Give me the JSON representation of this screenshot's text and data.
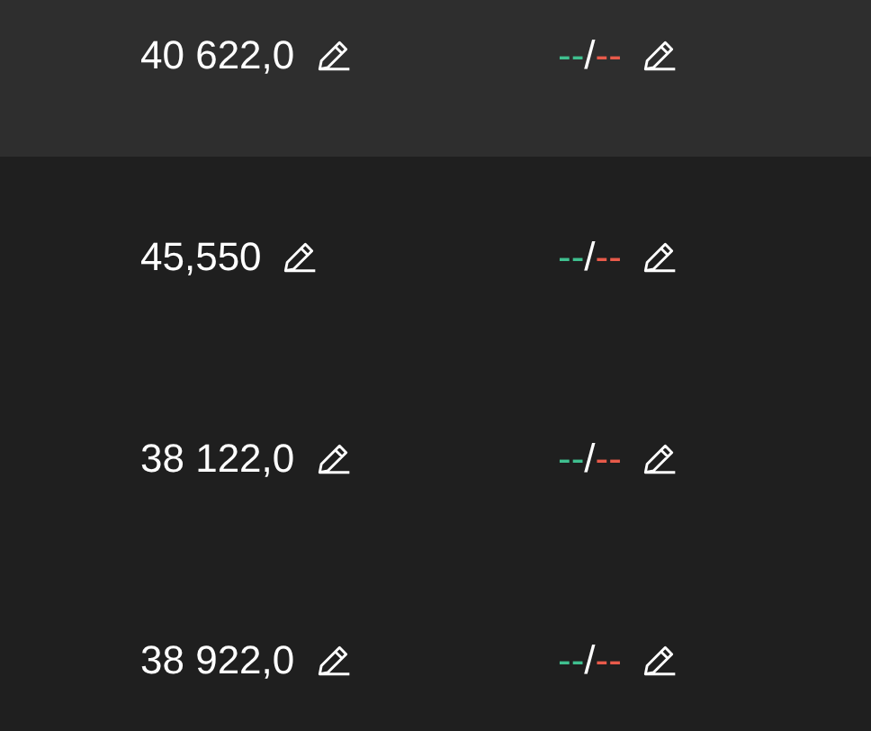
{
  "rows": [
    {
      "price": "40 622,0",
      "take_profit": "--",
      "separator": "/",
      "stop_loss": "--",
      "selected": true
    },
    {
      "price": "45,550",
      "take_profit": "--",
      "separator": "/",
      "stop_loss": "--",
      "selected": false
    },
    {
      "price": "38 122,0",
      "take_profit": "--",
      "separator": "/",
      "stop_loss": "--",
      "selected": false
    },
    {
      "price": "38 922,0",
      "take_profit": "--",
      "separator": "/",
      "stop_loss": "--",
      "selected": false
    }
  ]
}
